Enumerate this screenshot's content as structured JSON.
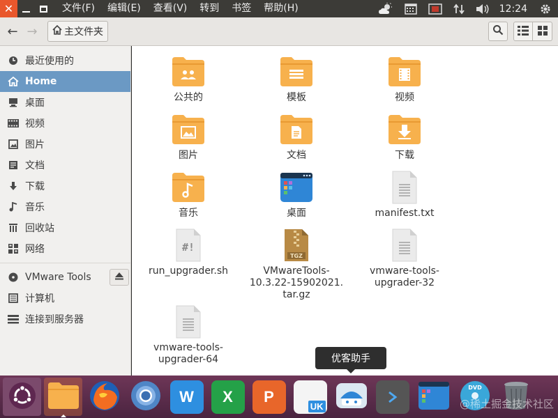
{
  "window": {
    "close_glyph": "✕"
  },
  "menu": [
    "文件(F)",
    "编辑(E)",
    "查看(V)",
    "转到",
    "书签",
    "帮助(H)"
  ],
  "tray": {
    "clock": "12:24",
    "icons": [
      "weather-icon",
      "calendar-icon",
      "record-icon",
      "network-icon",
      "volume-icon",
      "gear-icon"
    ]
  },
  "toolbar": {
    "path_label": "主文件夹",
    "back_glyph": "←",
    "forward_glyph": "→"
  },
  "sidebar": {
    "items": [
      {
        "label": "最近使用的",
        "icon": "clock-icon"
      },
      {
        "label": "Home",
        "icon": "home-icon",
        "active": true
      },
      {
        "label": "桌面",
        "icon": "desktop-icon"
      },
      {
        "label": "视频",
        "icon": "video-icon"
      },
      {
        "label": "图片",
        "icon": "picture-icon"
      },
      {
        "label": "文档",
        "icon": "document-icon"
      },
      {
        "label": "下载",
        "icon": "download-icon"
      },
      {
        "label": "音乐",
        "icon": "music-icon"
      },
      {
        "label": "回收站",
        "icon": "trash-icon"
      },
      {
        "label": "网络",
        "icon": "network-icon"
      }
    ],
    "devices": [
      {
        "label": "VMware Tools",
        "icon": "disc-icon"
      },
      {
        "label": "计算机",
        "icon": "computer-icon"
      },
      {
        "label": "连接到服务器",
        "icon": "server-icon"
      }
    ]
  },
  "files": [
    {
      "label": "公共的",
      "kind": "folder-public"
    },
    {
      "label": "模板",
      "kind": "folder-templates"
    },
    {
      "label": "视频",
      "kind": "folder-videos"
    },
    {
      "label": "图片",
      "kind": "folder-pictures"
    },
    {
      "label": "文档",
      "kind": "folder-documents"
    },
    {
      "label": "下载",
      "kind": "folder-downloads"
    },
    {
      "label": "音乐",
      "kind": "folder-music"
    },
    {
      "label": "桌面",
      "kind": "folder-desktop"
    },
    {
      "label": "manifest.txt",
      "kind": "text-file"
    },
    {
      "label": "run_upgrader.sh",
      "kind": "script-file",
      "badge": "#!"
    },
    {
      "label": "VMwareTools-\n10.3.22-15902021.\ntar.gz",
      "kind": "archive-file",
      "badge": "TGZ"
    },
    {
      "label": "vmware-tools-\nupgrader-32",
      "kind": "text-file"
    },
    {
      "label": "vmware-tools-\nupgrader-64",
      "kind": "text-file"
    }
  ],
  "tooltip": "优客助手",
  "dock": {
    "items": [
      "ubuntu-logo-icon",
      "files-icon",
      "firefox-icon",
      "chromium-icon",
      "wps-writer-icon",
      "wps-spreadsheet-icon",
      "wps-presentation-icon",
      "software-center-icon",
      "youker-assistant-icon",
      "terminal-icon",
      "workspace-icon",
      "dvd-icon",
      "trash-icon"
    ],
    "wps_w": "W",
    "wps_s": "X",
    "wps_p": "P",
    "uk": "UK",
    "dvd": "DVD"
  },
  "watermark": "@稀土掘金技术社区",
  "colors": {
    "folder": "#f7b14d",
    "folder_dark": "#e99a33",
    "active": "#6b99c4",
    "dock_top": "#6e3657",
    "close": "#e9572c"
  }
}
